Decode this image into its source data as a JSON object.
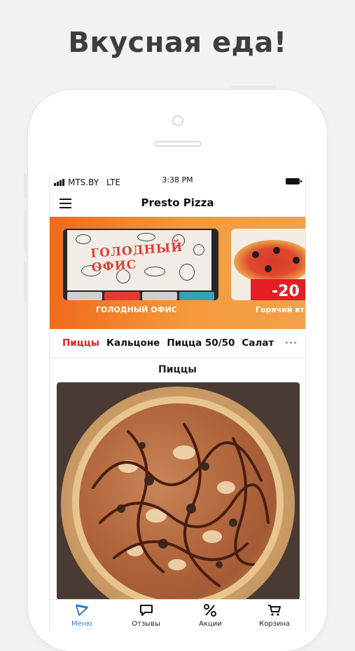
{
  "headline": "Вкусная еда!",
  "status_bar": {
    "carrier": "MTS.BY",
    "network": "LTE",
    "time": "3:38 PM"
  },
  "app_bar": {
    "title": "Presto Pizza",
    "menu_icon": "hamburger-menu-icon"
  },
  "banners": [
    {
      "poster_title": "ГОЛОДНЫЙ ОФИС",
      "caption": "ГОЛОДНЫЙ ОФИС"
    },
    {
      "sale_text": "-20",
      "caption": "Горячий вт"
    }
  ],
  "tabs": {
    "items": [
      "Пиццы",
      "Кальцоне",
      "Пицца 50/50",
      "Салат"
    ],
    "active": "Пиццы",
    "more_icon": "more-dots-icon"
  },
  "section": {
    "title": "Пиццы"
  },
  "bottom_nav": {
    "items": [
      {
        "label": "Меню",
        "icon": "pizza-slice-icon",
        "active": true
      },
      {
        "label": "Отзывы",
        "icon": "chat-bubble-icon",
        "active": false
      },
      {
        "label": "Акции",
        "icon": "percent-icon",
        "active": false
      },
      {
        "label": "Корзина",
        "icon": "cart-icon",
        "active": false
      }
    ]
  },
  "colors": {
    "accent_red": "#e31e24",
    "banner_orange": "#ef6a1c",
    "nav_active_blue": "#2a7fd4"
  }
}
